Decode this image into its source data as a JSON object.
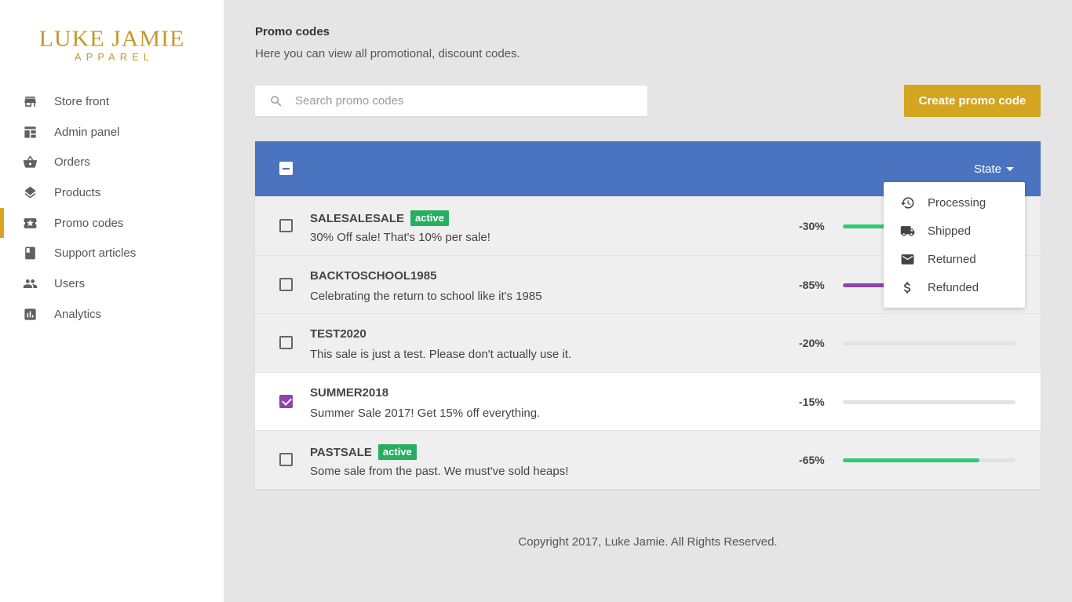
{
  "brand": {
    "name": "LUKE JAMIE",
    "tagline": "APPAREL",
    "color": "#c49a2c"
  },
  "sidebar": {
    "items": [
      {
        "label": "Store front",
        "icon": "store-icon",
        "active": false
      },
      {
        "label": "Admin panel",
        "icon": "dashboard-icon",
        "active": false
      },
      {
        "label": "Orders",
        "icon": "basket-icon",
        "active": false
      },
      {
        "label": "Products",
        "icon": "layers-icon",
        "active": false
      },
      {
        "label": "Promo codes",
        "icon": "ticket-icon",
        "active": true
      },
      {
        "label": "Support articles",
        "icon": "book-icon",
        "active": false
      },
      {
        "label": "Users",
        "icon": "users-icon",
        "active": false
      },
      {
        "label": "Analytics",
        "icon": "chart-icon",
        "active": false
      }
    ]
  },
  "header": {
    "title": "Promo codes",
    "subtitle": "Here you can view all promotional, discount codes."
  },
  "search": {
    "placeholder": "Search promo codes",
    "value": ""
  },
  "create_button": {
    "label": "Create promo code",
    "color": "#d4a520"
  },
  "table": {
    "header_color": "#4a74bf",
    "state_label": "State",
    "rows": [
      {
        "code": "SALESALESALE",
        "badge": "active",
        "description": "30% Off sale! That's 10% per sale!",
        "discount": "-30%",
        "progress": 0.55,
        "bar_color": "#2ecc71",
        "checked": false
      },
      {
        "code": "BACKTOSCHOOL1985",
        "badge": "",
        "description": "Celebrating the return to school like it's 1985",
        "discount": "-85%",
        "progress": 0.45,
        "bar_color": "#8e44ad",
        "checked": false
      },
      {
        "code": "TEST2020",
        "badge": "",
        "description": "This sale is just a test. Please don't actually use it.",
        "discount": "-20%",
        "progress": 0.0,
        "bar_color": "#2ecc71",
        "checked": false
      },
      {
        "code": "SUMMER2018",
        "badge": "",
        "description": "Summer Sale 2017! Get 15% off everything.",
        "discount": "-15%",
        "progress": 0.0,
        "bar_color": "#2ecc71",
        "checked": true
      },
      {
        "code": "PASTSALE",
        "badge": "active",
        "description": "Some sale from the past. We must've sold heaps!",
        "discount": "-65%",
        "progress": 0.79,
        "bar_color": "#2ecc71",
        "checked": false
      }
    ]
  },
  "state_menu": {
    "items": [
      {
        "label": "Processing",
        "icon": "history-icon"
      },
      {
        "label": "Shipped",
        "icon": "truck-icon"
      },
      {
        "label": "Returned",
        "icon": "mail-icon"
      },
      {
        "label": "Refunded",
        "icon": "dollar-icon"
      }
    ]
  },
  "footer": {
    "text": "Copyright 2017, Luke Jamie. All Rights Reserved."
  }
}
